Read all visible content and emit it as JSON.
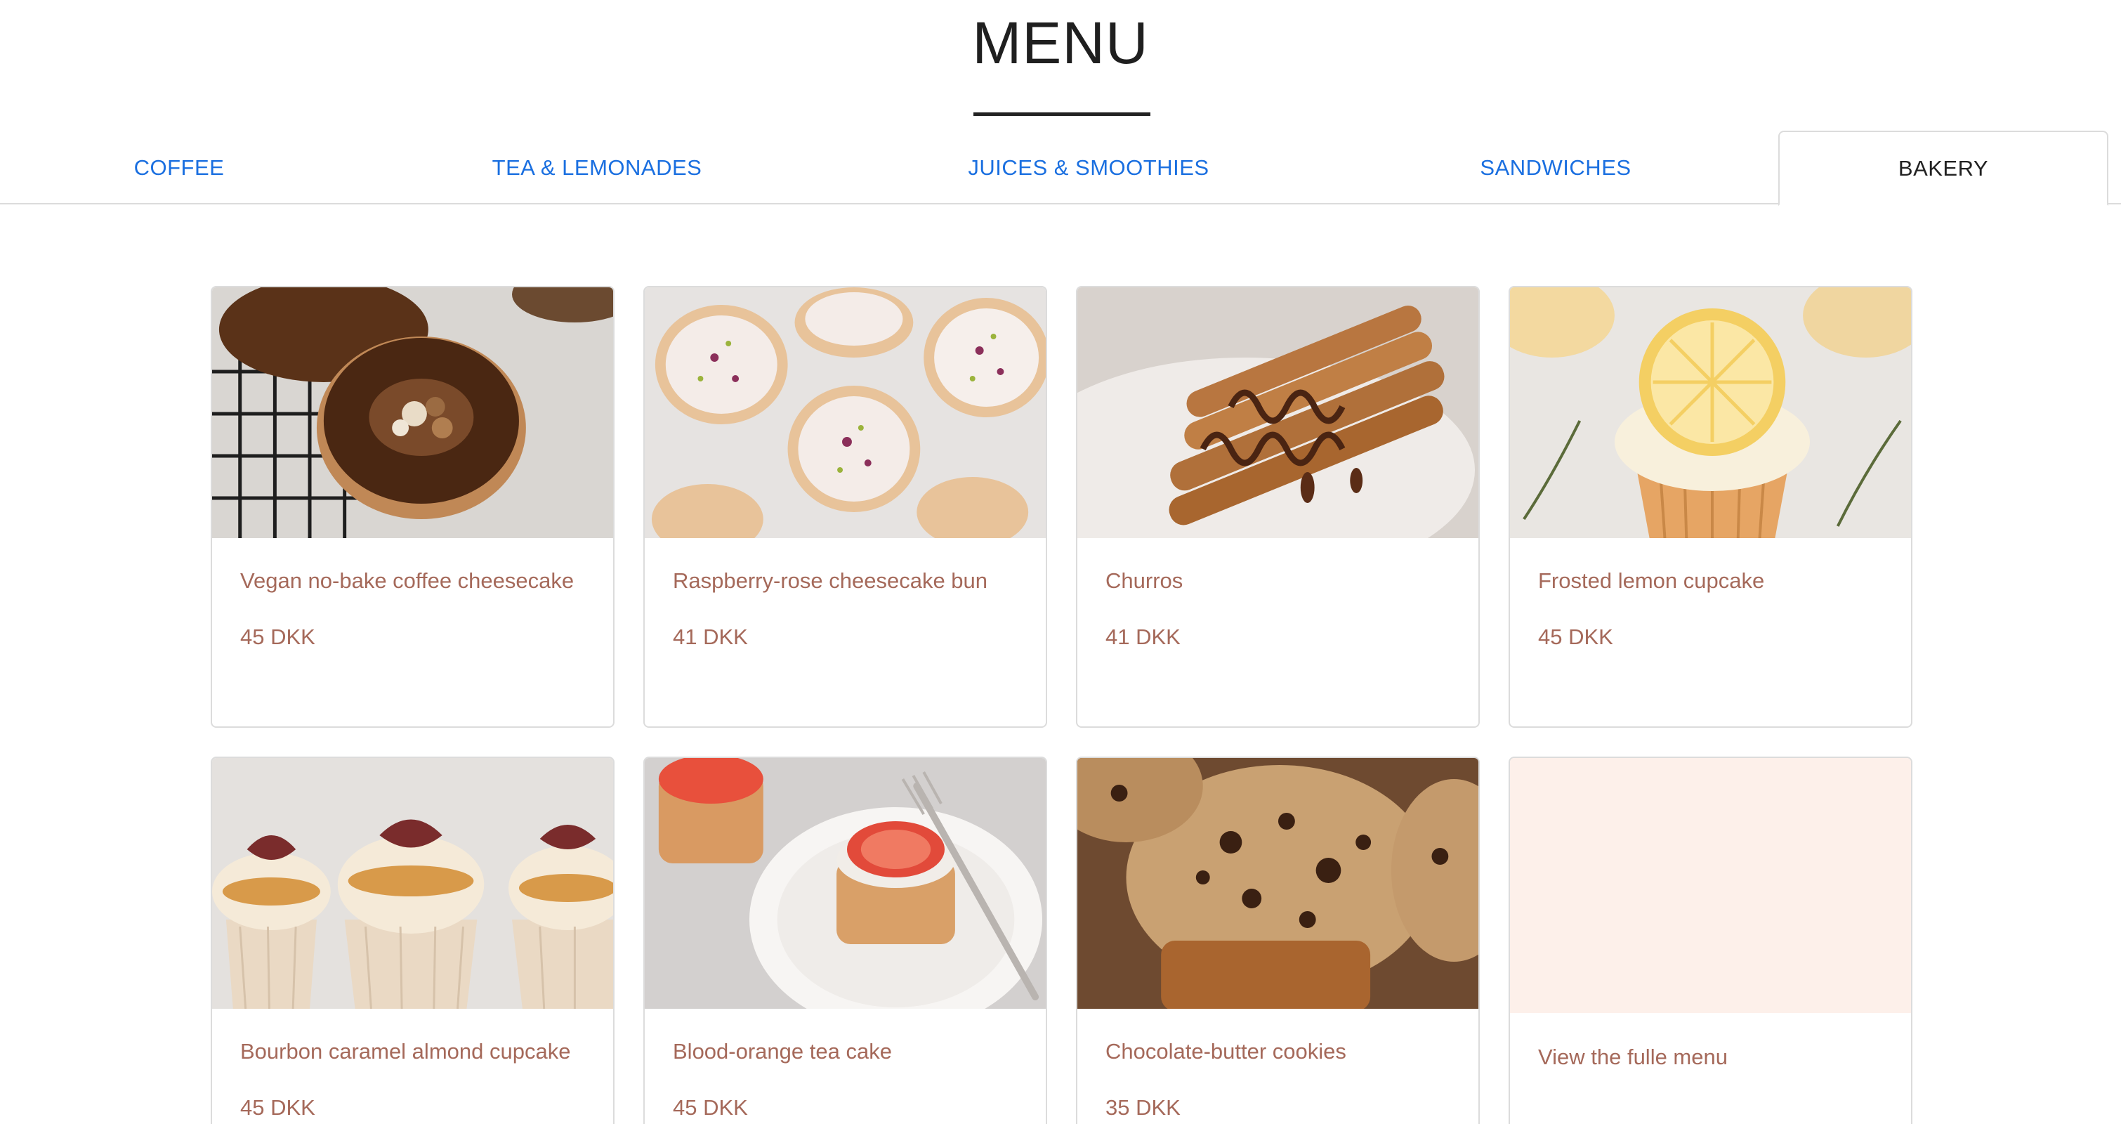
{
  "header": {
    "title": "MENU"
  },
  "tabs": [
    {
      "label": "COFFEE",
      "active": false
    },
    {
      "label": "TEA & LEMONADES",
      "active": false
    },
    {
      "label": "JUICES & SMOOTHIES",
      "active": false
    },
    {
      "label": "SANDWICHES",
      "active": false
    },
    {
      "label": "BAKERY",
      "active": true
    }
  ],
  "products": [
    {
      "name": "Vegan no-bake coffee cheesecake",
      "price": "45 DKK"
    },
    {
      "name": "Raspberry-rose cheesecake bun",
      "price": "41 DKK"
    },
    {
      "name": "Churros",
      "price": "41 DKK"
    },
    {
      "name": "Frosted lemon cupcake",
      "price": "45 DKK"
    },
    {
      "name": "Bourbon caramel almond cupcake",
      "price": "45 DKK"
    },
    {
      "name": "Blood-orange tea cake",
      "price": "45 DKK"
    },
    {
      "name": "Chocolate-butter cookies",
      "price": "35 DKK"
    }
  ],
  "more": {
    "label": "View the fulle menu"
  },
  "colors": {
    "tab_link": "#1a6fe0",
    "product_text": "#a5695a",
    "placeholder_bg": "#fdf0ea"
  }
}
